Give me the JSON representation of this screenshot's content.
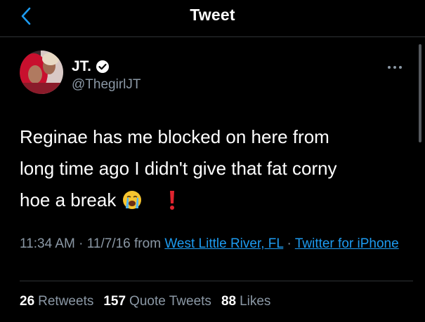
{
  "header": {
    "title": "Tweet",
    "back_icon": "chevron-left-icon"
  },
  "tweet": {
    "author": {
      "display_name": "JT.",
      "verified_icon": "verified-badge-icon",
      "handle": "@ThegirlJT"
    },
    "more_icon": "more-horizontal-icon",
    "text": {
      "line1": "Reginae has me blocked on here from",
      "line2": "long time ago I didn't give that fat corny",
      "line3": "hoe a break",
      "emojis": [
        "loudly-crying-face-icon",
        "red-exclamation-icon"
      ]
    },
    "meta": {
      "time": "11:34 AM",
      "sep1": " · ",
      "date": "11/7/16",
      "from": " from ",
      "location": "West Little River, FL",
      "sep2": " · ",
      "source": "Twitter for iPhone"
    },
    "stats": {
      "retweets_count": "26",
      "retweets_label": "Retweets",
      "quotes_count": "157",
      "quotes_label": "Quote Tweets",
      "likes_count": "88",
      "likes_label": "Likes"
    }
  },
  "colors": {
    "background": "#000000",
    "text": "#ffffff",
    "secondary_text": "#8b98a5",
    "link": "#1d9bf0",
    "divider": "#2f3336"
  }
}
